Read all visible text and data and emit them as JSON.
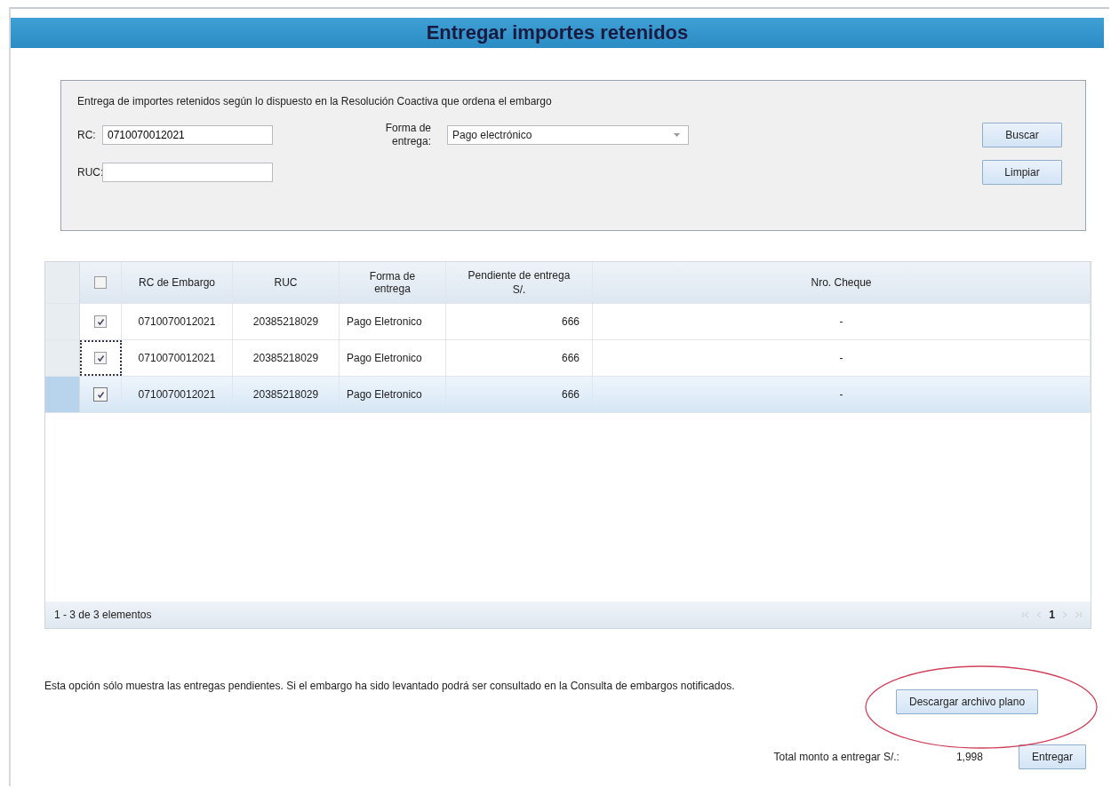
{
  "title": "Entregar importes retenidos",
  "filter": {
    "description": "Entrega de importes retenidos según lo dispuesto en la Resolución Coactiva que ordena el embargo",
    "rc_label": "RC:",
    "rc_value": "0710070012021",
    "ruc_label": "RUC:",
    "forma_label": "Forma de entrega:",
    "forma_value": "Pago electrónico",
    "buttons": [
      "Buscar",
      "Limpiar"
    ]
  },
  "table": {
    "select_all": {
      "checked": false
    },
    "columns": [
      "RC de Embargo",
      "RUC",
      "Forma de entrega",
      "Pendiente de entrega S/.",
      "Nro. Cheque"
    ],
    "rows": [
      {
        "checked": true,
        "selected": false,
        "focused": false,
        "cells": [
          "0710070012021",
          "20385218029",
          "Pago Eletronico",
          "666",
          "-"
        ]
      },
      {
        "checked": true,
        "selected": false,
        "focused": true,
        "cells": [
          "0710070012021",
          "20385218029",
          "Pago Eletronico",
          "666",
          "-"
        ]
      },
      {
        "checked": true,
        "selected": true,
        "focused": false,
        "cells": [
          "0710070012021",
          "20385218029",
          "Pago Eletronico",
          "666",
          "-"
        ]
      }
    ],
    "pager_info": "1 - 3 de 3 elementos",
    "current_page": "1"
  },
  "note": "Esta opción sólo muestra las entregas pendientes. Si el embargo ha sido levantado podrá ser consultado en la Consulta de embargos notificados.",
  "download_button": {
    "label": "Descargar archivo plano",
    "highlighted": true
  },
  "total": {
    "label": "Total monto a entregar S/.:",
    "value": "1,998",
    "button": "Entregar"
  }
}
